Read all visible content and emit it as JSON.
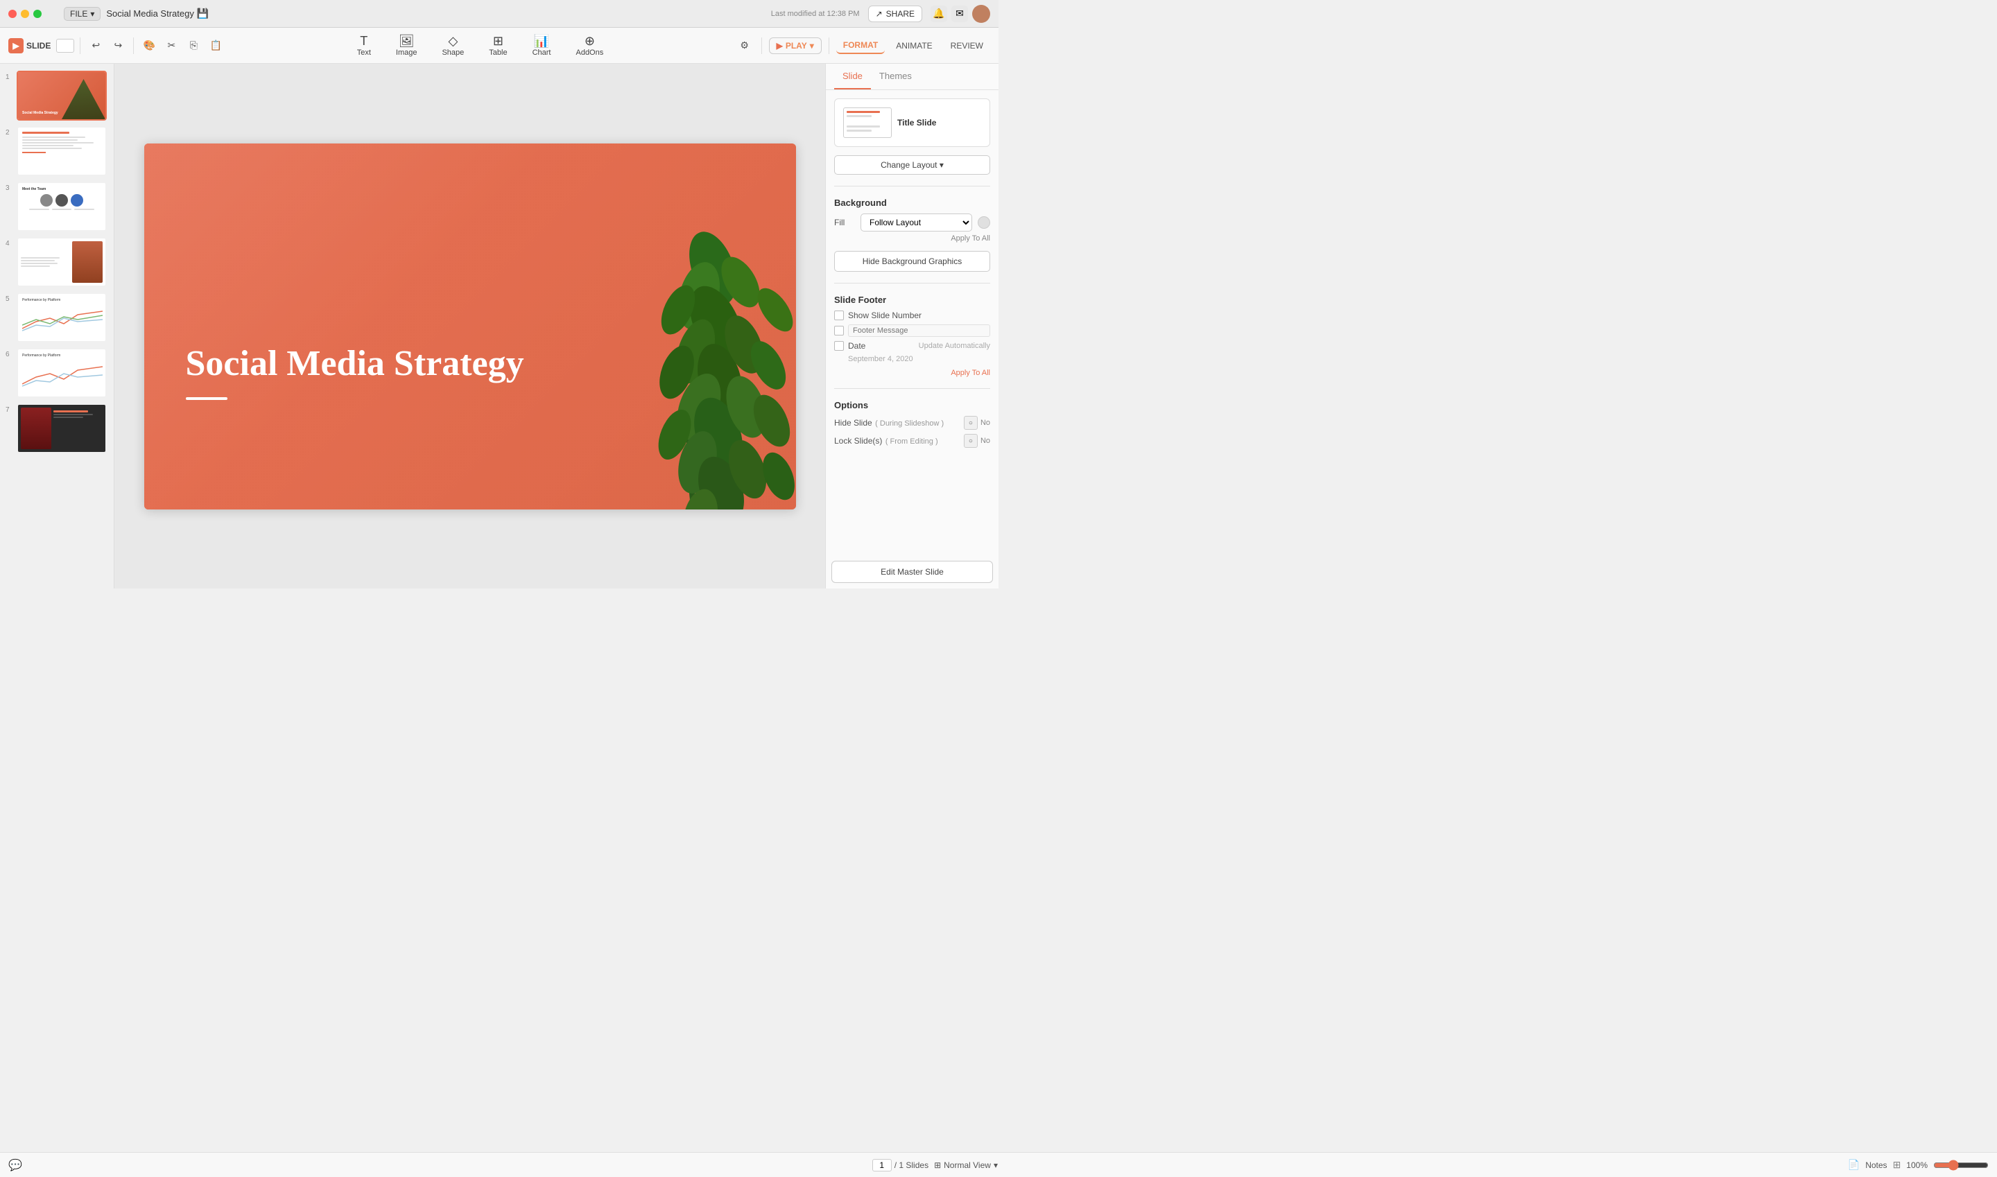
{
  "window": {
    "title": "Social Media Strategy"
  },
  "titlebar": {
    "file_label": "FILE",
    "doc_name": "Social Media Strategy",
    "last_modified": "Last modified at 12:38 PM",
    "share_label": "SHARE"
  },
  "toolbar": {
    "slide_label": "SLIDE",
    "undo_label": "↩",
    "redo_label": "↪",
    "play_label": "PLAY",
    "format_label": "FORMAT",
    "animate_label": "ANIMATE",
    "review_label": "REVIEW",
    "tools": [
      {
        "id": "text",
        "icon": "T",
        "label": "Text"
      },
      {
        "id": "image",
        "icon": "🖼",
        "label": "Image"
      },
      {
        "id": "shape",
        "icon": "◇",
        "label": "Shape"
      },
      {
        "id": "table",
        "icon": "⊞",
        "label": "Table"
      },
      {
        "id": "chart",
        "icon": "📊",
        "label": "Chart"
      },
      {
        "id": "addons",
        "icon": "⊕",
        "label": "AddOns"
      }
    ]
  },
  "slides": [
    {
      "num": 1,
      "active": true,
      "type": "title"
    },
    {
      "num": 2,
      "active": false,
      "type": "overview"
    },
    {
      "num": 3,
      "active": false,
      "type": "team"
    },
    {
      "num": 4,
      "active": false,
      "type": "content"
    },
    {
      "num": 5,
      "active": false,
      "type": "chart"
    },
    {
      "num": 6,
      "active": false,
      "type": "chart2"
    },
    {
      "num": 7,
      "active": false,
      "type": "gallery"
    }
  ],
  "main_slide": {
    "title": "Social Media Strategy",
    "bg_color": "#e87a60"
  },
  "right_panel": {
    "tabs": [
      {
        "id": "slide",
        "label": "Slide",
        "active": true
      },
      {
        "id": "themes",
        "label": "Themes",
        "active": false
      }
    ],
    "layout": {
      "title": "Title Slide",
      "change_layout_label": "Change Layout ▾"
    },
    "background": {
      "section_title": "Background",
      "fill_label": "Fill",
      "fill_option": "Follow Layout",
      "apply_all_label": "Apply To All"
    },
    "hide_bg_btn": "Hide Background Graphics",
    "footer": {
      "section_title": "Slide Footer",
      "show_slide_number_label": "Show Slide Number",
      "footer_message_label": "Footer Message",
      "footer_placeholder": "Footer Message",
      "date_label": "Date",
      "date_auto_label": "Update Automatically",
      "date_value": "September 4, 2020",
      "apply_all_label": "Apply To All"
    },
    "options": {
      "section_title": "Options",
      "hide_slide_label": "Hide Slide",
      "hide_slide_sub": "( During Slideshow )",
      "hide_slide_no": "No",
      "lock_slide_label": "Lock Slide(s)",
      "lock_slide_sub": "( From Editing )",
      "lock_slide_no": "No"
    },
    "edit_master_btn": "Edit Master Slide"
  },
  "bottom_bar": {
    "page_current": "1",
    "page_total": "/ 1 Slides",
    "normal_view_label": "Normal View",
    "notes_label": "Notes",
    "zoom_level": "100%"
  }
}
